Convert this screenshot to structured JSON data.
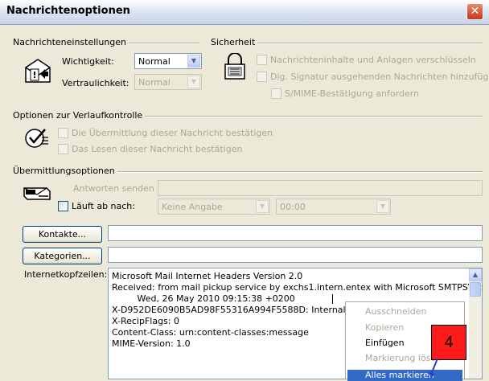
{
  "window": {
    "title": "Nachrichtenoptionen",
    "close_glyph": "✕"
  },
  "message_settings": {
    "title": "Nachrichteneinstellungen",
    "importance_label": "Wichtigkeit:",
    "importance_value": "Normal",
    "sensitivity_label": "Vertraulichkeit:",
    "sensitivity_value": "Normal"
  },
  "security": {
    "title": "Sicherheit",
    "encrypt_label": "Nachrichteninhalte und Anlagen verschlüsseln",
    "sign_label": "Dig. Signatur ausgehenden Nachrichten hinzufügen",
    "smime_label": "S/MIME-Bestätigung anfordern"
  },
  "tracking": {
    "title": "Optionen zur Verlaufkontrolle",
    "delivery_label": "Die Übermittlung dieser Nachricht bestätigen",
    "read_label": "Das Lesen dieser Nachricht bestätigen"
  },
  "delivery": {
    "title": "Übermittlungsoptionen",
    "reply_to_label": "Antworten senden an:",
    "expires_label": "Läuft ab nach:",
    "expires_date": "Keine Angabe",
    "expires_time": "00:00"
  },
  "contacts_button": "Kontakte...",
  "categories_button": "Kategorien...",
  "headers": {
    "label": "Internetkopfzeilen:",
    "lines": [
      "Microsoft Mail Internet Headers Version 2.0",
      "Received: from mail pickup service by exchs1.intern.entex with Microsoft SMTPSVC;",
      "         Wed, 26 May 2010 09:15:38 +0200",
      "X-D952DE6090B5AD98F55316A994F5588D: Internal",
      "X-RecipFlags: 0",
      "Content-Class: urn:content-classes:message",
      "MIME-Version: 1.0"
    ]
  },
  "context_menu": {
    "cut": "Ausschneiden",
    "copy": "Kopieren",
    "paste": "Einfügen",
    "delete": "Markierung lösch",
    "select_all": "Alles markieren"
  },
  "annotation_badge": "4",
  "colors": {
    "badge": "#ff1a1a",
    "selection": "#316ac5",
    "dialog": "#ece9d8"
  }
}
